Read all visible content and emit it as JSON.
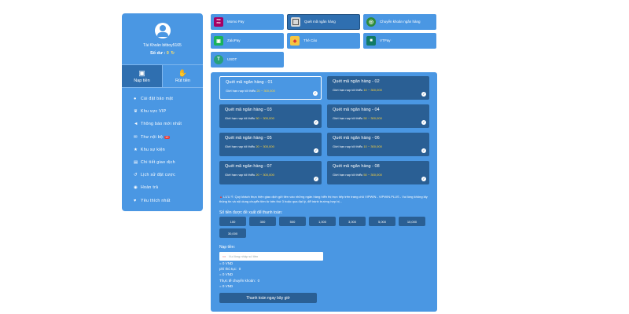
{
  "sidebar": {
    "account_name": "Tài Khoản bitboy5165",
    "balance_label": "Số dư :",
    "balance_value": "0",
    "refresh_icon": "refresh-icon",
    "actions": [
      {
        "label": "Nạp tiền",
        "icon": "wallet-icon",
        "active": true
      },
      {
        "label": "Rút tiền",
        "icon": "hand-coin-icon",
        "active": false
      }
    ],
    "menu": [
      {
        "label": "Cài đặt bảo mật",
        "icon": "user-lock-icon"
      },
      {
        "label": "Khu vực VIP",
        "icon": "crown-icon"
      },
      {
        "label": "Thông báo mới nhất",
        "icon": "megaphone-icon"
      },
      {
        "label": "Thư nội bộ",
        "icon": "mail-icon",
        "badge": "10"
      },
      {
        "label": "Khu sự kiện",
        "icon": "trophy-icon"
      },
      {
        "label": "Chi tiết giao dịch",
        "icon": "document-icon"
      },
      {
        "label": "Lịch sử đặt cược",
        "icon": "history-icon"
      },
      {
        "label": "Hoàn trả",
        "icon": "refund-icon"
      },
      {
        "label": "Yêu thích nhất",
        "icon": "heart-icon"
      }
    ]
  },
  "methods": [
    {
      "label": "Momo Pay",
      "icon": "momo-logo-icon",
      "logo_text": "mo\nmo",
      "active": false
    },
    {
      "label": "Quét mã ngân hàng",
      "icon": "qr-code-icon",
      "active": true
    },
    {
      "label": "Chuyển khoản ngân hàng",
      "icon": "bank-globe-icon",
      "active": false
    },
    {
      "label": "ZaloPay",
      "icon": "zalopay-logo-icon",
      "active": false
    },
    {
      "label": "Thẻ Cào",
      "icon": "scratch-card-icon",
      "active": false
    },
    {
      "label": "VTPay",
      "icon": "vtpay-logo-icon",
      "active": false
    },
    {
      "label": "USDT",
      "icon": "usdt-logo-icon",
      "active": false
    }
  ],
  "banks": [
    {
      "title": "Quét mã ngân hàng - 01",
      "limit_label": "Giới hạn nạp tối thiểu",
      "range": "20 ~ 300,000",
      "active": true
    },
    {
      "title": "Quét mã ngân hàng - 02",
      "limit_label": "Giới hạn nạp tối thiểu",
      "range": "10 ~ 300,000",
      "active": false
    },
    {
      "title": "Quét mã ngân hàng - 03",
      "limit_label": "Giới hạn nạp tối thiểu",
      "range": "50 ~ 300,000",
      "active": false
    },
    {
      "title": "Quét mã ngân hàng - 04",
      "limit_label": "Giới hạn nạp tối thiểu",
      "range": "50 ~ 300,000",
      "active": false
    },
    {
      "title": "Quét mã ngân hàng - 05",
      "limit_label": "Giới hạn nạp tối thiểu",
      "range": "20 ~ 300,000",
      "active": false
    },
    {
      "title": "Quét mã ngân hàng - 06",
      "limit_label": "Giới hạn nạp tối thiểu",
      "range": "10 ~ 300,000",
      "active": false
    },
    {
      "title": "Quét mã ngân hàng - 07",
      "limit_label": "Giới hạn nạp tối thiểu",
      "range": "20 ~ 300,000",
      "active": false
    },
    {
      "title": "Quét mã ngân hàng - 08",
      "limit_label": "Giới hạn nạp tối thiểu",
      "range": "50 ~ 300,000",
      "active": false
    }
  ],
  "notice": {
    "icon": "warning-icon",
    "text": "LƯU Ý: Quý khách thực hiện giao dịch gửi tiền vào những ngân hàng hiển thị trực tiếp trên trang chủ VIPWIN - VIPWIN.PLUS - Vui lòng không lấy thông tin và nội dung chuyển tiền từ bên thứ 3 hoặc qua đại lý, để tránh trường hợp bị..."
  },
  "amounts": {
    "label": "Số tiền được đề xuất để thanh toán:",
    "options": [
      "100",
      "300",
      "500",
      "1,000",
      "3,000",
      "5,000",
      "10,000",
      "30,000"
    ]
  },
  "deposit": {
    "label": "Nạp tiền:",
    "placeholder": "Vui lòng nhập số tiền",
    "icon": "money-icon",
    "equals_vnd": "= 0 VND",
    "fee_label": "phí thủ tục:",
    "fee_value": "0",
    "fee_vnd": "= 0 VND",
    "actual_label": "Thực tế chuyển khoản:",
    "actual_value": "0",
    "actual_vnd": "= 0 VND"
  },
  "submit_label": "Thanh toán ngay bây giờ"
}
